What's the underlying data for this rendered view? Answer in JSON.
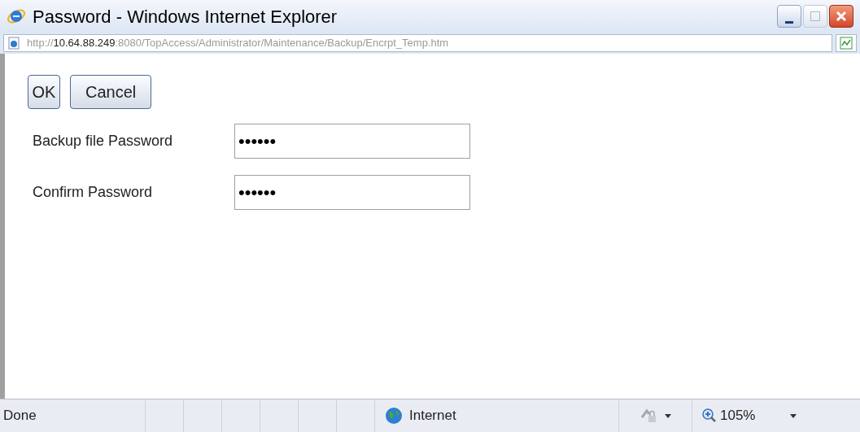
{
  "window": {
    "title": "Password - Windows Internet Explorer"
  },
  "address_bar": {
    "scheme": "http://",
    "host": "10.64.88.249",
    "path": ":8080/TopAccess/Administrator/Maintenance/Backup/Encrpt_Temp.htm"
  },
  "buttons": [
    "OK",
    "Cancel"
  ],
  "fields": [
    {
      "label": "Backup file Password",
      "value": "••••••"
    },
    {
      "label": "Confirm Password",
      "value": "••••••"
    }
  ],
  "status_bar": {
    "status": "Done",
    "zone": "Internet",
    "zoom": "105%"
  }
}
